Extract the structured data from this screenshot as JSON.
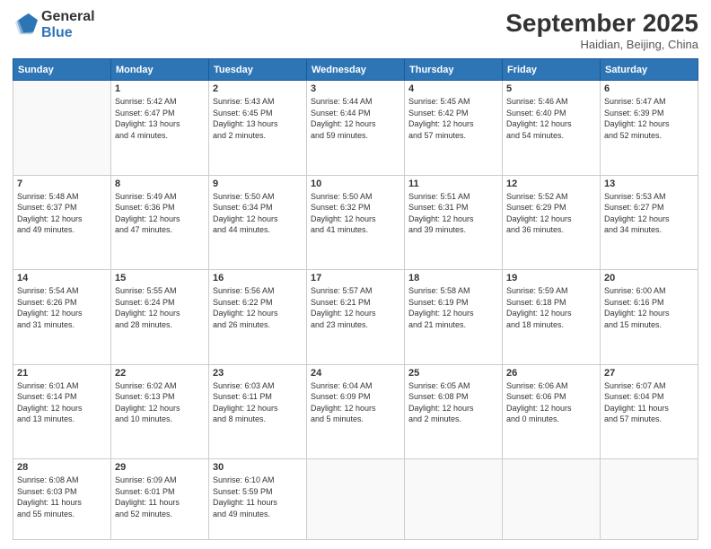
{
  "header": {
    "logo_line1": "General",
    "logo_line2": "Blue",
    "month": "September 2025",
    "location": "Haidian, Beijing, China"
  },
  "days_of_week": [
    "Sunday",
    "Monday",
    "Tuesday",
    "Wednesday",
    "Thursday",
    "Friday",
    "Saturday"
  ],
  "weeks": [
    [
      {
        "day": "",
        "info": ""
      },
      {
        "day": "1",
        "info": "Sunrise: 5:42 AM\nSunset: 6:47 PM\nDaylight: 13 hours\nand 4 minutes."
      },
      {
        "day": "2",
        "info": "Sunrise: 5:43 AM\nSunset: 6:45 PM\nDaylight: 13 hours\nand 2 minutes."
      },
      {
        "day": "3",
        "info": "Sunrise: 5:44 AM\nSunset: 6:44 PM\nDaylight: 12 hours\nand 59 minutes."
      },
      {
        "day": "4",
        "info": "Sunrise: 5:45 AM\nSunset: 6:42 PM\nDaylight: 12 hours\nand 57 minutes."
      },
      {
        "day": "5",
        "info": "Sunrise: 5:46 AM\nSunset: 6:40 PM\nDaylight: 12 hours\nand 54 minutes."
      },
      {
        "day": "6",
        "info": "Sunrise: 5:47 AM\nSunset: 6:39 PM\nDaylight: 12 hours\nand 52 minutes."
      }
    ],
    [
      {
        "day": "7",
        "info": "Sunrise: 5:48 AM\nSunset: 6:37 PM\nDaylight: 12 hours\nand 49 minutes."
      },
      {
        "day": "8",
        "info": "Sunrise: 5:49 AM\nSunset: 6:36 PM\nDaylight: 12 hours\nand 47 minutes."
      },
      {
        "day": "9",
        "info": "Sunrise: 5:50 AM\nSunset: 6:34 PM\nDaylight: 12 hours\nand 44 minutes."
      },
      {
        "day": "10",
        "info": "Sunrise: 5:50 AM\nSunset: 6:32 PM\nDaylight: 12 hours\nand 41 minutes."
      },
      {
        "day": "11",
        "info": "Sunrise: 5:51 AM\nSunset: 6:31 PM\nDaylight: 12 hours\nand 39 minutes."
      },
      {
        "day": "12",
        "info": "Sunrise: 5:52 AM\nSunset: 6:29 PM\nDaylight: 12 hours\nand 36 minutes."
      },
      {
        "day": "13",
        "info": "Sunrise: 5:53 AM\nSunset: 6:27 PM\nDaylight: 12 hours\nand 34 minutes."
      }
    ],
    [
      {
        "day": "14",
        "info": "Sunrise: 5:54 AM\nSunset: 6:26 PM\nDaylight: 12 hours\nand 31 minutes."
      },
      {
        "day": "15",
        "info": "Sunrise: 5:55 AM\nSunset: 6:24 PM\nDaylight: 12 hours\nand 28 minutes."
      },
      {
        "day": "16",
        "info": "Sunrise: 5:56 AM\nSunset: 6:22 PM\nDaylight: 12 hours\nand 26 minutes."
      },
      {
        "day": "17",
        "info": "Sunrise: 5:57 AM\nSunset: 6:21 PM\nDaylight: 12 hours\nand 23 minutes."
      },
      {
        "day": "18",
        "info": "Sunrise: 5:58 AM\nSunset: 6:19 PM\nDaylight: 12 hours\nand 21 minutes."
      },
      {
        "day": "19",
        "info": "Sunrise: 5:59 AM\nSunset: 6:18 PM\nDaylight: 12 hours\nand 18 minutes."
      },
      {
        "day": "20",
        "info": "Sunrise: 6:00 AM\nSunset: 6:16 PM\nDaylight: 12 hours\nand 15 minutes."
      }
    ],
    [
      {
        "day": "21",
        "info": "Sunrise: 6:01 AM\nSunset: 6:14 PM\nDaylight: 12 hours\nand 13 minutes."
      },
      {
        "day": "22",
        "info": "Sunrise: 6:02 AM\nSunset: 6:13 PM\nDaylight: 12 hours\nand 10 minutes."
      },
      {
        "day": "23",
        "info": "Sunrise: 6:03 AM\nSunset: 6:11 PM\nDaylight: 12 hours\nand 8 minutes."
      },
      {
        "day": "24",
        "info": "Sunrise: 6:04 AM\nSunset: 6:09 PM\nDaylight: 12 hours\nand 5 minutes."
      },
      {
        "day": "25",
        "info": "Sunrise: 6:05 AM\nSunset: 6:08 PM\nDaylight: 12 hours\nand 2 minutes."
      },
      {
        "day": "26",
        "info": "Sunrise: 6:06 AM\nSunset: 6:06 PM\nDaylight: 12 hours\nand 0 minutes."
      },
      {
        "day": "27",
        "info": "Sunrise: 6:07 AM\nSunset: 6:04 PM\nDaylight: 11 hours\nand 57 minutes."
      }
    ],
    [
      {
        "day": "28",
        "info": "Sunrise: 6:08 AM\nSunset: 6:03 PM\nDaylight: 11 hours\nand 55 minutes."
      },
      {
        "day": "29",
        "info": "Sunrise: 6:09 AM\nSunset: 6:01 PM\nDaylight: 11 hours\nand 52 minutes."
      },
      {
        "day": "30",
        "info": "Sunrise: 6:10 AM\nSunset: 5:59 PM\nDaylight: 11 hours\nand 49 minutes."
      },
      {
        "day": "",
        "info": ""
      },
      {
        "day": "",
        "info": ""
      },
      {
        "day": "",
        "info": ""
      },
      {
        "day": "",
        "info": ""
      }
    ]
  ]
}
